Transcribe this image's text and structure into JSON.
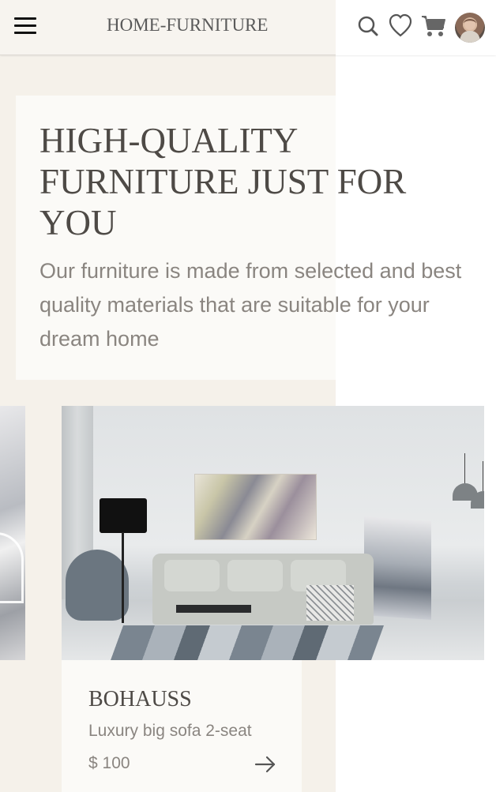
{
  "header": {
    "brand": "HOME-FURNITURE",
    "icons": [
      "menu-icon",
      "search-icon",
      "heart-icon",
      "cart-icon",
      "avatar"
    ]
  },
  "hero": {
    "title": "HIGH-QUALITY FURNITURE JUST FOR YOU",
    "subtitle": "Our furniture is made from selected and best quality materials that are suitable for your dream home"
  },
  "product": {
    "name": "BOHAUSS",
    "description": "Luxury big sofa 2-seat",
    "price": "$ 100",
    "arrow_icon": "arrow-right-icon"
  },
  "colors": {
    "panel_bg": "#f5f1ea",
    "card_bg": "#fbfaf7",
    "title_text": "#4e4a46",
    "muted_text": "#8a8580"
  }
}
